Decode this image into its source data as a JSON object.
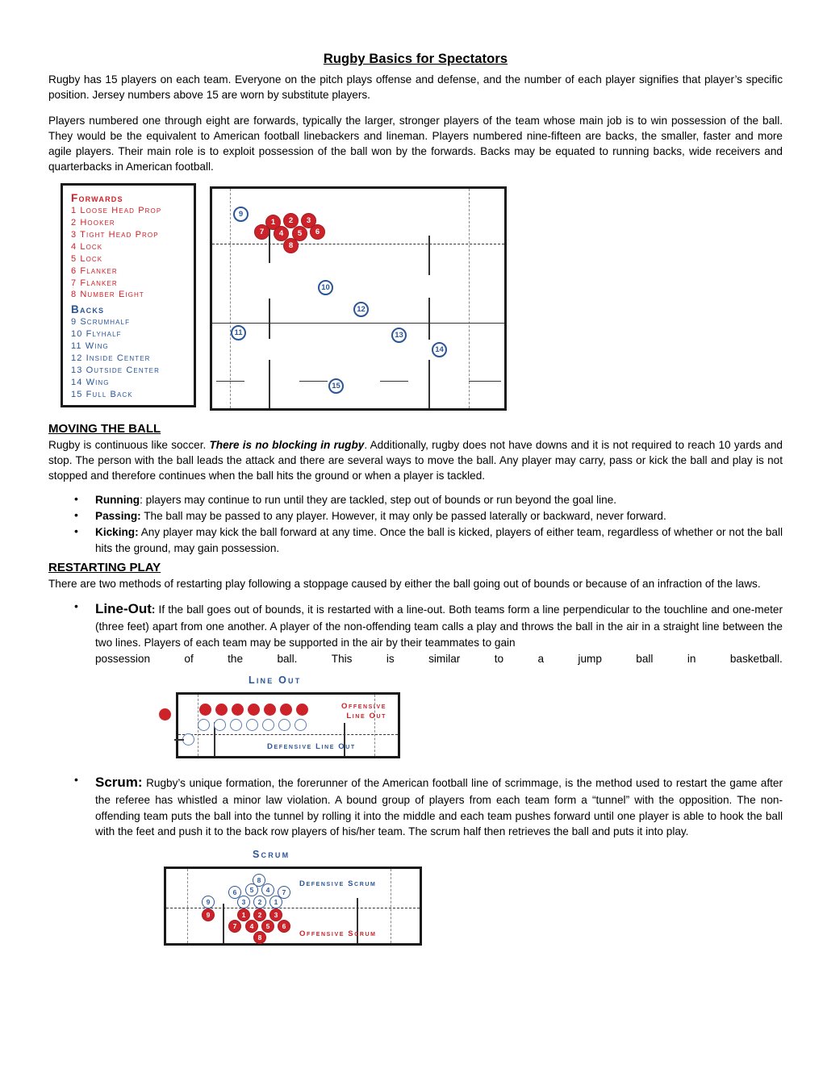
{
  "document": {
    "title": "Rugby Basics for Spectators",
    "intro_paragraph": "Rugby has 15 players on each team. Everyone on the pitch plays offense and defense, and the number of each player signifies that player’s specific position. Jersey numbers above 15 are worn by substitute players.",
    "forwards_backs_paragraph": "Players numbered one through eight are forwards, typically the larger, stronger players of the team whose main job is to win possession of the ball. They would be the equivalent to American football linebackers and lineman. Players numbered nine-fifteen are backs, the smaller, faster and more agile players. Their main role is to exploit possession of the ball won by the forwards. Backs may be equated to running backs, wide receivers and quarterbacks in American football."
  },
  "positions_legend": {
    "forwards_heading": "Forwards",
    "forwards": [
      "1 Loose Head Prop",
      "2 Hooker",
      "3 Tight Head Prop",
      "4 Lock",
      "5 Lock",
      "6 Flanker",
      "7 Flanker",
      "8 Number Eight"
    ],
    "backs_heading": "Backs",
    "backs": [
      "9  Scrumhalf",
      "10 Flyhalf",
      "11 Wing",
      "12 Inside Center",
      "13 Outside Center",
      "14 Wing",
      "15 Full Back"
    ]
  },
  "pitch_diagram": {
    "forward_markers": [
      "1",
      "2",
      "3",
      "4",
      "5",
      "6",
      "7",
      "8"
    ],
    "back_markers": [
      "9",
      "10",
      "11",
      "12",
      "13",
      "14",
      "15"
    ]
  },
  "moving_the_ball": {
    "heading": "MOVING THE BALL",
    "intro_before_bold": "Rugby is continuous like soccer. ",
    "intro_bold": "There is no blocking in rugby",
    "intro_after_bold": ". Additionally, rugby does not have downs and it is not required to reach 10 yards and stop. The person with the ball leads the attack and there are several ways to move the ball. Any player may carry, pass or kick the ball and play is not stopped and therefore continues when the ball hits the ground or when a player is tackled.",
    "bullets": [
      {
        "lead": "Running",
        "lead_punct": ":",
        "text": " players may continue to run until they are tackled, step out of bounds or run beyond the goal line."
      },
      {
        "lead": "Passing",
        "lead_punct": ":",
        "text": " The ball may be passed to any player. However, it may only be passed laterally or backward, never forward."
      },
      {
        "lead": " Kicking",
        "lead_punct": ":",
        "text": " Any player may kick the ball forward at any time. Once the ball is kicked, players of either team, regardless of whether or not the ball hits the ground, may gain possession."
      }
    ]
  },
  "restarting_play": {
    "heading": "RESTARTING PLAY",
    "intro": "There are two methods of restarting play following a stoppage caused by either the ball going out of bounds or because of an infraction of the laws.",
    "line_out": {
      "lead": "Line-Out",
      "lead_punct": ":",
      "text": " If the ball goes out of bounds, it is restarted with a line-out. Both teams form a line perpendicular to the touchline and one-meter (three feet) apart from one another. A player of the non-offending team calls a play and throws the ball in the air in a straight line between the two lines. Players of each team may be supported in the air by their teammates to gain",
      "last_line_words": [
        "possession",
        "of",
        "the",
        "ball.",
        "This",
        "is",
        "similar",
        "to",
        "a",
        "jump",
        "ball",
        "in",
        "basketball."
      ]
    },
    "scrum": {
      "lead": "Scrum:",
      "text": " Rugby’s unique formation, the forerunner of the American football line of scrimmage, is the method used to restart the game after the referee has whistled a minor law violation. A bound group of players from each team form a “tunnel” with the opposition. The non-offending team puts the ball into the tunnel by rolling it into the middle and each team pushes forward until one player is able to hook the ball with the feet and push it to the back row players of his/her team. The scrum half then retrieves the ball and puts it into play."
    }
  },
  "line_out_diagram": {
    "title": "Line Out",
    "offensive_label_line1": "Offensive",
    "offensive_label_line2": "Line Out",
    "defensive_label": "Defensive Line Out",
    "offensive_count": 7,
    "defensive_count": 7
  },
  "scrum_diagram": {
    "title": "Scrum",
    "defensive_label": "Defensive Scrum",
    "offensive_label": "Offensive Scrum",
    "defensive_markers": [
      "8",
      "6",
      "5",
      "4",
      "7",
      "3",
      "2",
      "1",
      "9"
    ],
    "offensive_markers": [
      "1",
      "2",
      "3",
      "7",
      "4",
      "5",
      "6",
      "8",
      "9"
    ]
  },
  "colors": {
    "forward_red": "#cc2229",
    "back_blue": "#2a5699",
    "line_black": "#1a1a1a"
  }
}
